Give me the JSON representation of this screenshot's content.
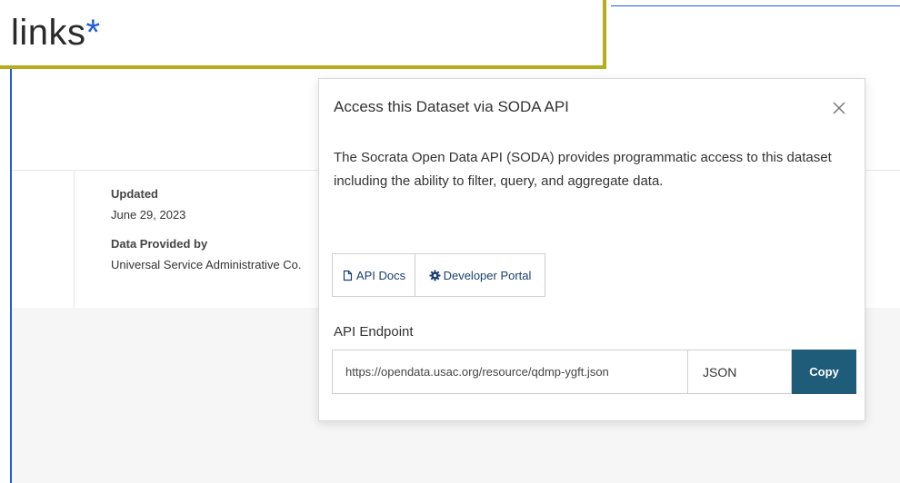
{
  "callout": {
    "text": "links",
    "marker": "*"
  },
  "dataset_meta": {
    "updated_label": "Updated",
    "updated_value": "June 29, 2023",
    "provider_label": "Data Provided by",
    "provider_value": "Universal Service Administrative Co."
  },
  "modal": {
    "title": "Access this Dataset via SODA API",
    "close_icon": "close-icon",
    "description": "The Socrata Open Data API (SODA) provides programmatic access to this dataset including the ability to filter, query, and aggregate data.",
    "buttons": {
      "api_docs": "API Docs",
      "developer_portal": "Developer Portal"
    },
    "endpoint": {
      "label": "API Endpoint",
      "value": "https://opendata.usac.org/resource/qdmp-ygft.json",
      "format": "JSON",
      "copy_label": "Copy"
    }
  },
  "colors": {
    "accent_blue": "#1f5cd8",
    "callout_border": "#b5ad1b",
    "copy_button": "#1e5c7a"
  }
}
